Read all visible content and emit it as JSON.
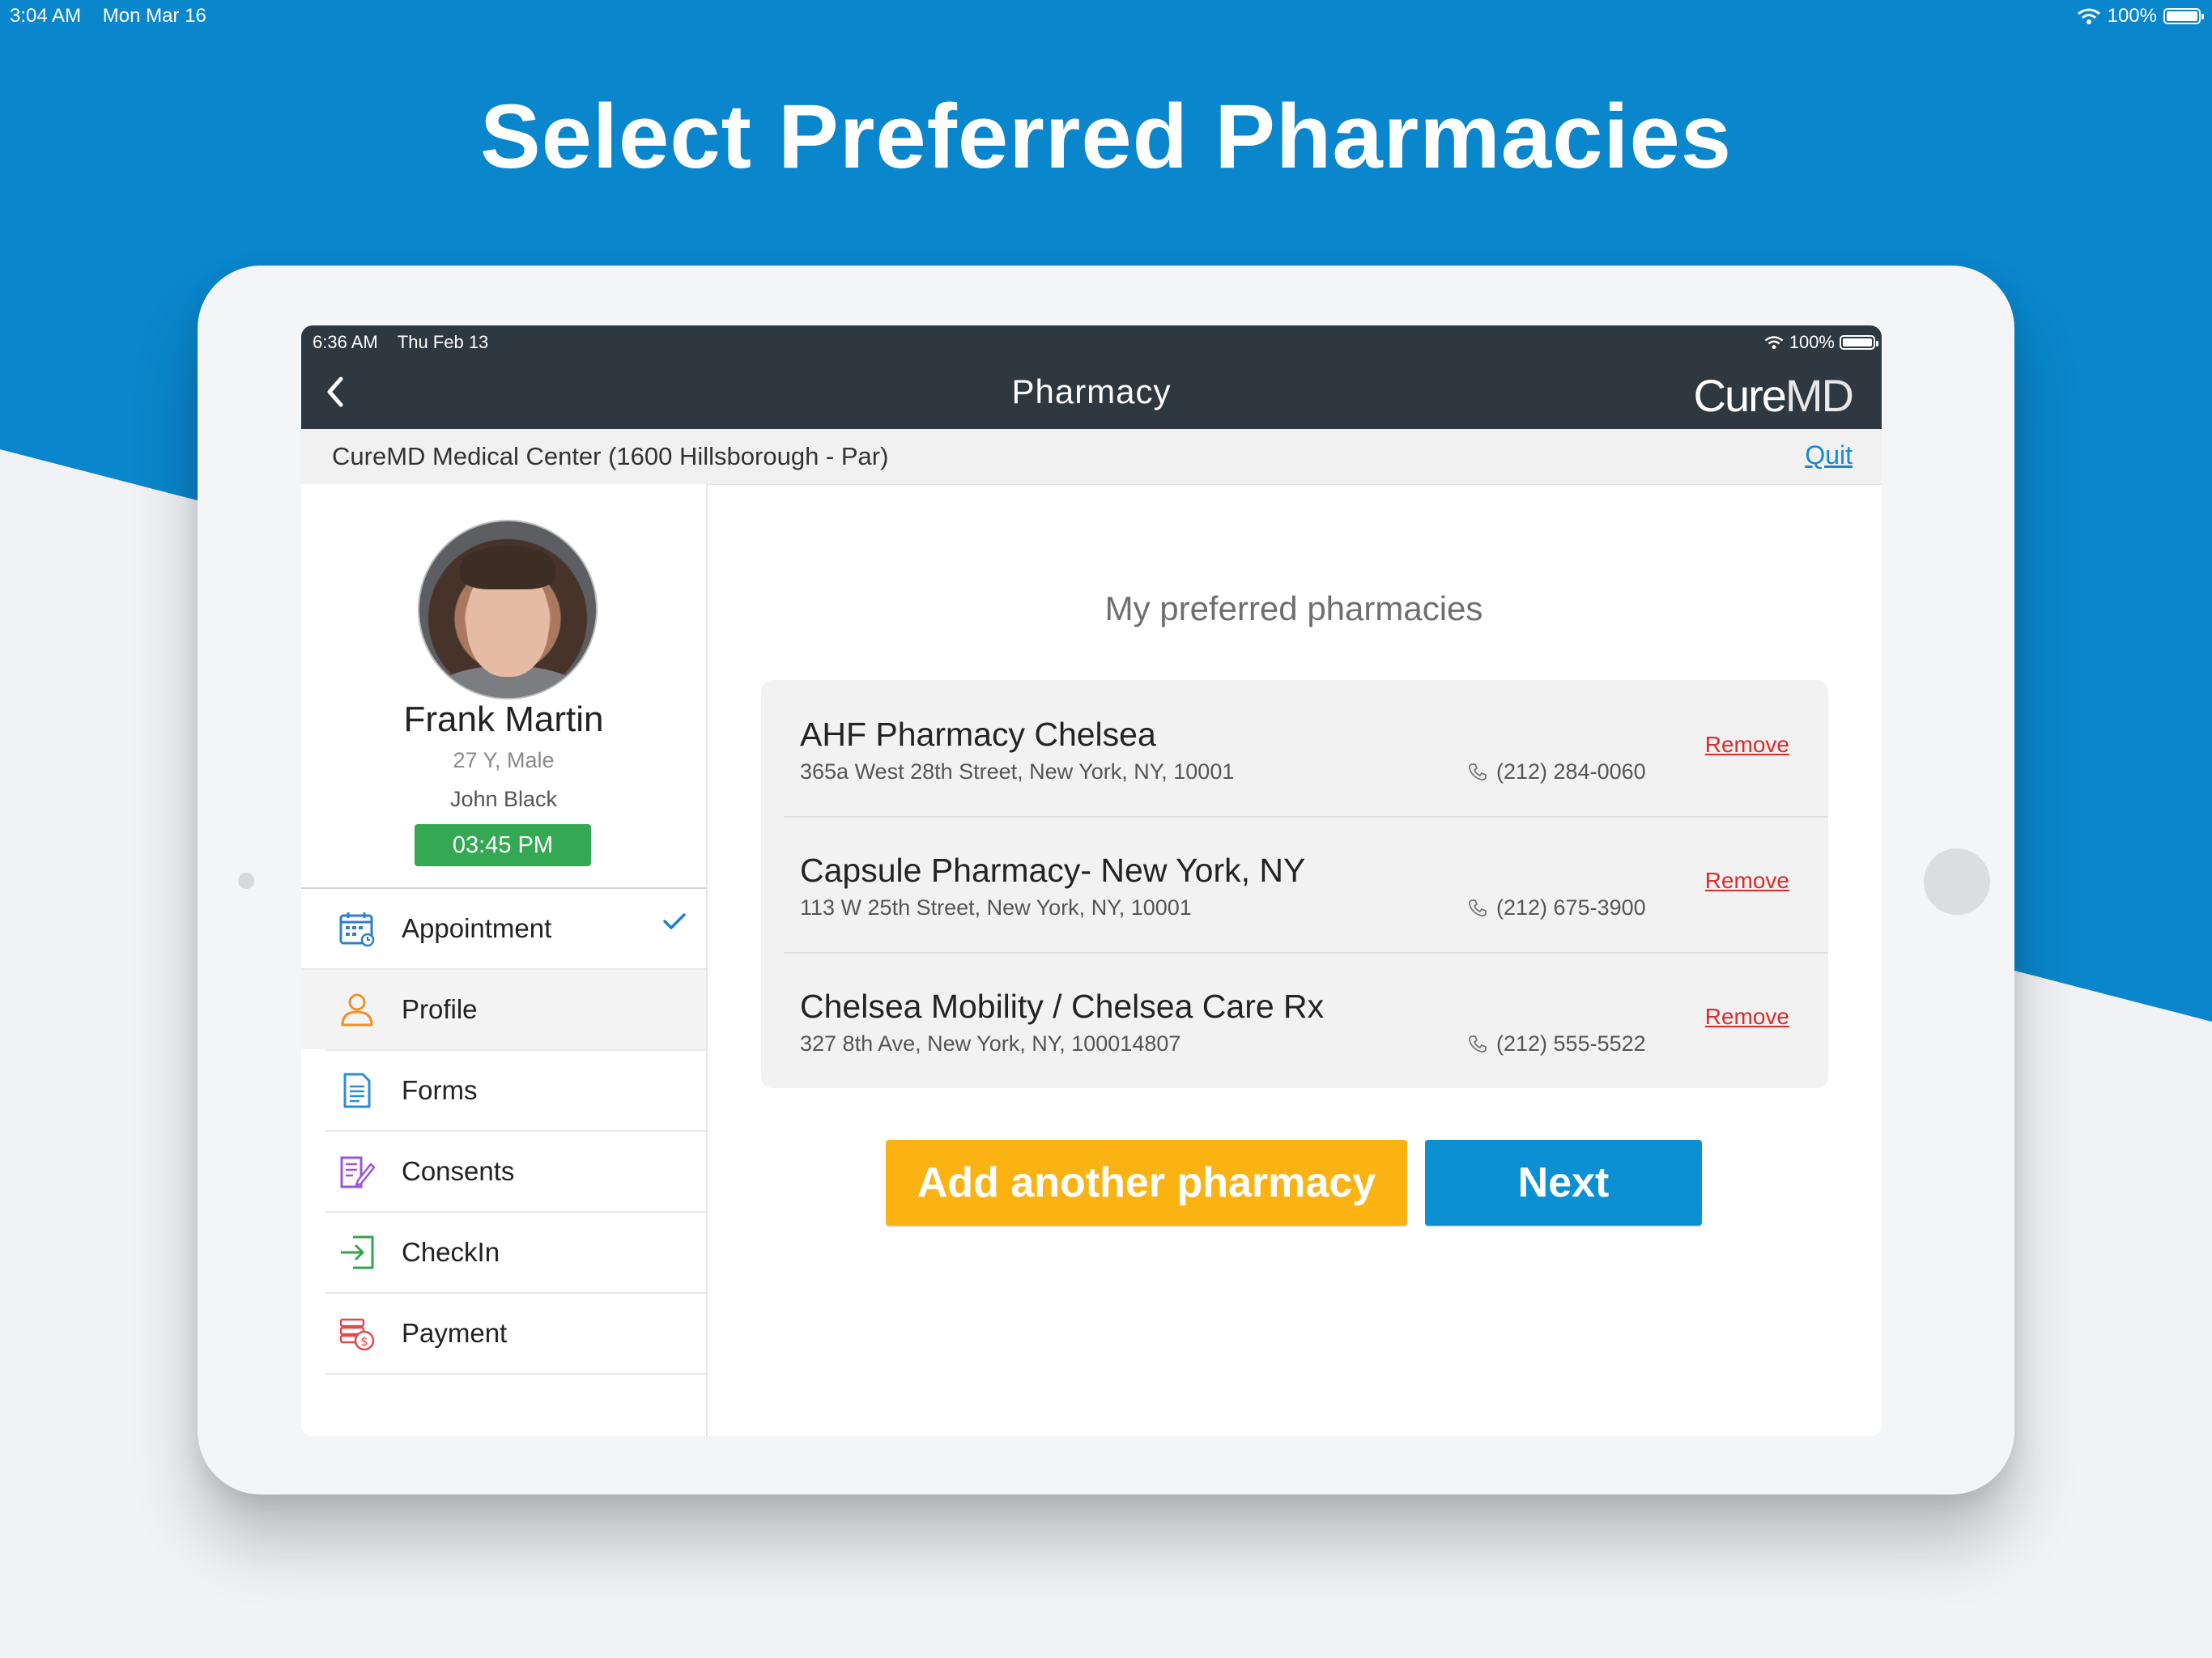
{
  "outer_status": {
    "time": "3:04 AM",
    "date": "Mon Mar 16",
    "battery": "100%"
  },
  "headline": "Select Preferred Pharmacies",
  "device_status": {
    "time": "6:36 AM",
    "date": "Thu Feb 13",
    "battery": "100%"
  },
  "topbar": {
    "title": "Pharmacy",
    "logo_cure": "Cure",
    "logo_md": "MD"
  },
  "clinic": {
    "name": "CureMD Medical Center (1600 Hillsborough - Par)",
    "quit_label": "Quit"
  },
  "patient": {
    "name": "Frank Martin",
    "info": "27 Y, Male",
    "doctor": "John Black",
    "time": "03:45 PM"
  },
  "nav": {
    "items": [
      {
        "label": "Appointment",
        "icon": "calendar-icon",
        "color": "#2f7fc8"
      },
      {
        "label": "Profile",
        "icon": "user-icon",
        "color": "#f0922a"
      },
      {
        "label": "Forms",
        "icon": "document-icon",
        "color": "#2a8fd6"
      },
      {
        "label": "Consents",
        "icon": "consent-icon",
        "color": "#9b55d6"
      },
      {
        "label": "CheckIn",
        "icon": "checkin-icon",
        "color": "#33a34e"
      },
      {
        "label": "Payment",
        "icon": "payment-icon",
        "color": "#e24b4b"
      }
    ]
  },
  "main": {
    "heading": "My preferred pharmacies",
    "pharmacies": [
      {
        "name": "AHF Pharmacy Chelsea",
        "address": "365a West 28th Street, New York, NY, 10001",
        "phone": "(212) 284-0060",
        "remove_label": "Remove"
      },
      {
        "name": "Capsule Pharmacy- New York, NY",
        "address": "113 W 25th Street, New York, NY, 10001",
        "phone": "(212) 675-3900",
        "remove_label": "Remove"
      },
      {
        "name": "Chelsea Mobility / Chelsea Care Rx",
        "address": "327 8th Ave, New York, NY, 100014807",
        "phone": "(212) 555-5522",
        "remove_label": "Remove"
      }
    ],
    "add_label": "Add another pharmacy",
    "next_label": "Next"
  },
  "colors": {
    "brand_blue": "#0a86cc",
    "accent_yellow": "#fbb314",
    "button_blue": "#0c8fd3",
    "time_green": "#35a853",
    "remove_red": "#e02a2a"
  }
}
